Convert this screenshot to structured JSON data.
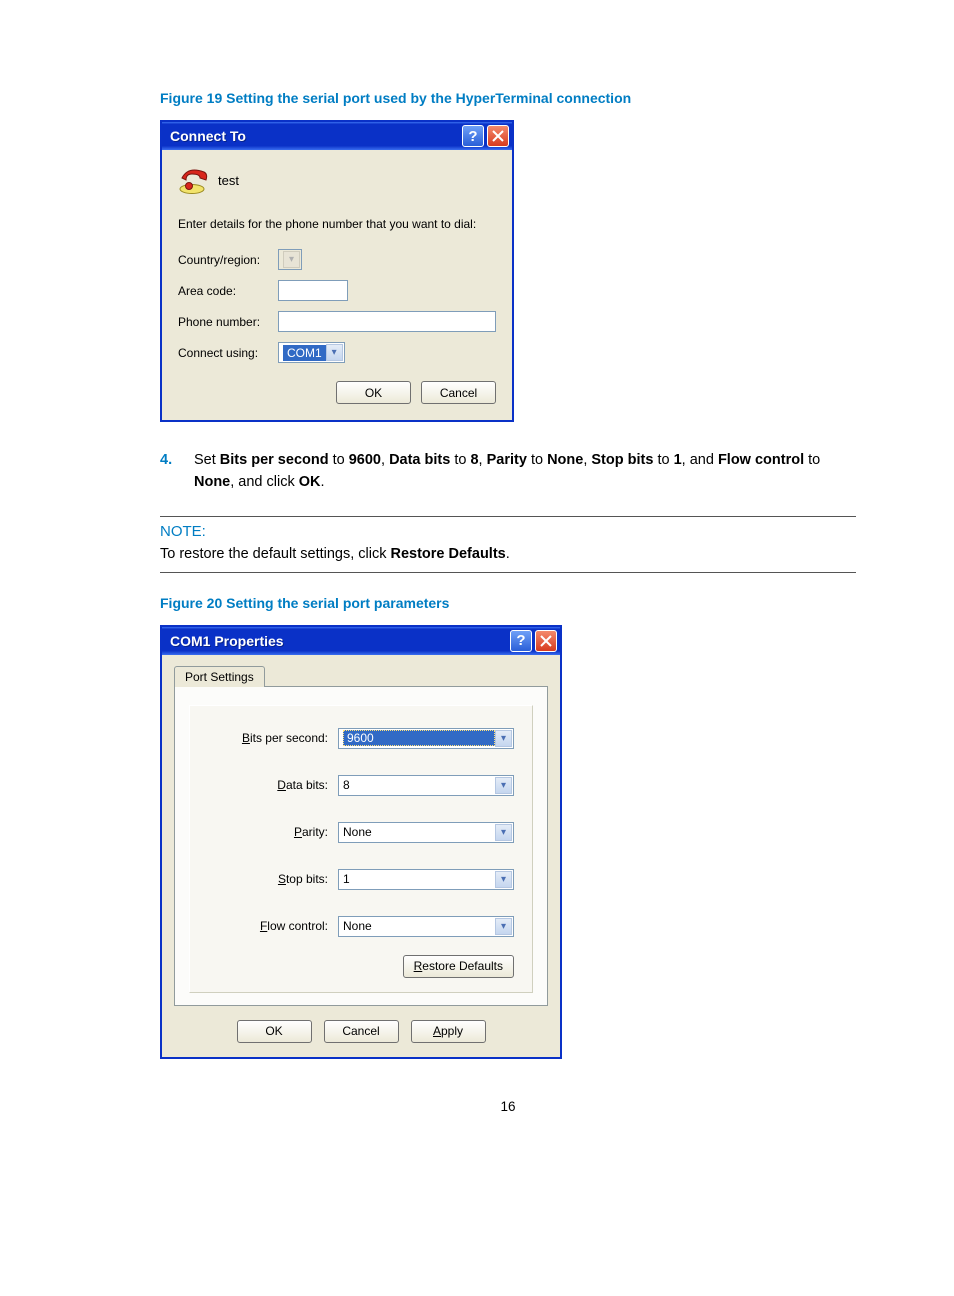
{
  "figure19_caption": "Figure 19 Setting the serial port used by the HyperTerminal connection",
  "dlg1": {
    "title": "Connect To",
    "conn_name": "test",
    "instruction": "Enter details for the phone number that you want to dial:",
    "lbl_country": "Country/region:",
    "lbl_area": "Area code:",
    "lbl_phone": "Phone number:",
    "lbl_connect": "Connect using:",
    "val_connect": "COM1",
    "ok": "OK",
    "cancel": "Cancel"
  },
  "step4": {
    "num": "4.",
    "t1": "Set ",
    "b1": "Bits per second",
    "t2": " to ",
    "b2": "9600",
    "t3": ", ",
    "b3": "Data bits",
    "t4": " to ",
    "b4": "8",
    "t5": ", ",
    "b5": "Parity",
    "t6": " to ",
    "b6": "None",
    "t7": ", ",
    "b7": "Stop bits",
    "t8": " to ",
    "b8": "1",
    "t9": ", and ",
    "b9": "Flow control",
    "t10": " to ",
    "b10": "None",
    "t11": ", and click ",
    "b11": "OK",
    "t12": "."
  },
  "note": {
    "label": "NOTE:",
    "t1": "To restore the default settings, click ",
    "b1": "Restore Defaults",
    "t2": "."
  },
  "figure20_caption": "Figure 20 Setting the serial port parameters",
  "dlg2": {
    "title": "COM1 Properties",
    "tab": "Port Settings",
    "lbl_bits": "Bits per second:",
    "val_bits": "9600",
    "lbl_data": "Data bits:",
    "val_data": "8",
    "lbl_parity": "Parity:",
    "val_parity": "None",
    "lbl_stop": "Stop bits:",
    "val_stop": "1",
    "lbl_flow": "Flow control:",
    "val_flow": "None",
    "restore": "Restore Defaults",
    "ok": "OK",
    "cancel": "Cancel",
    "apply": "Apply"
  },
  "pagenum": "16"
}
